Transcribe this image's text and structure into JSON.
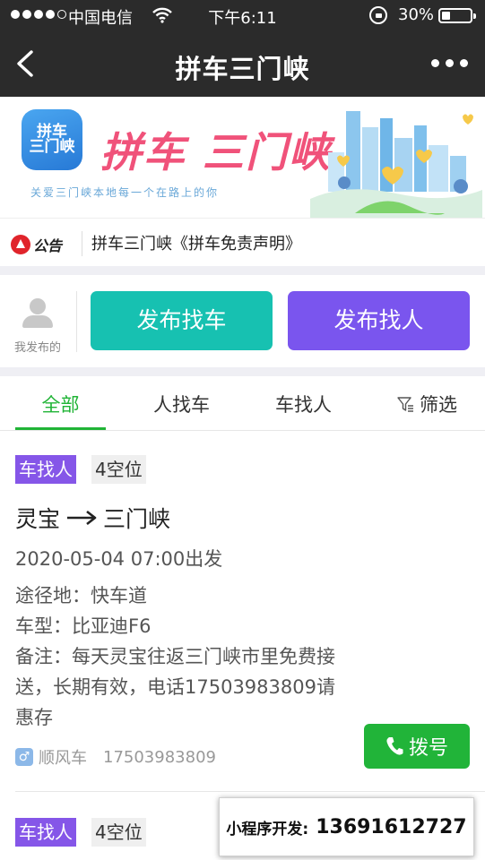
{
  "status_bar": {
    "carrier": "中国电信",
    "time": "下午6:11",
    "battery": "30%",
    "battery_level": 0.3,
    "signal_bars_filled": 4,
    "signal_bars_total": 5
  },
  "nav": {
    "title": "拼车三门峡"
  },
  "banner": {
    "app_icon_text": "拼车\n三门峡",
    "brand": "拼车 三门峡",
    "slogan": "关爱三门峡本地每一个在路上的你"
  },
  "notice": {
    "logo_label": "公告",
    "text": "拼车三门峡《拼车免责声明》"
  },
  "publish": {
    "mine_label": "我发布的",
    "find_car_label": "发布找车",
    "find_person_label": "发布找人"
  },
  "tabs": {
    "all": "全部",
    "person_finds_car": "人找车",
    "car_finds_person": "车找人",
    "filter": "筛选"
  },
  "listings": [
    {
      "type": "车找人",
      "seats": "4空位",
      "from": "灵宝",
      "to": "三门峡",
      "departure": "2020-05-04 07:00出发",
      "via": "途径地：快车道",
      "vehicle": "车型：比亚迪F6",
      "note": "备注：每天灵宝往返三门峡市里免费接送，长期有效，电话17503983809请惠存",
      "poster_gender": "♂",
      "poster_name": "顺风车",
      "poster_phone": "17503983809",
      "dial_label": "拨号"
    },
    {
      "type": "车找人",
      "seats": "4空位"
    }
  ],
  "ad": {
    "label": "小程序开发:",
    "phone": "13691612727"
  },
  "colors": {
    "bar": "#2b2b2b",
    "accent_green": "#20b436",
    "teal": "#17c1b1",
    "purple": "#7a55ee",
    "brand_pink": "#f0527a"
  }
}
